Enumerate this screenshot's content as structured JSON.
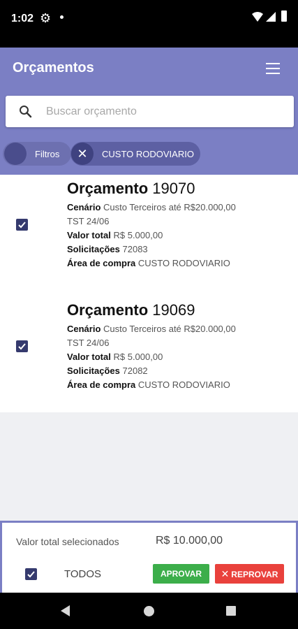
{
  "status_bar": {
    "time": "1:02"
  },
  "header": {
    "title": "Orçamentos",
    "search_placeholder": "Buscar orçamento",
    "chips": {
      "filtros_label": "Filtros",
      "active_filter_label": "CUSTO RODOVIARIO"
    }
  },
  "orcamentos": [
    {
      "title_prefix": "Orçamento",
      "number": "19070",
      "cenario_label": "Cenário",
      "cenario_value": "Custo Terceiros até R$20.000,00",
      "cenario_value_line2": "TST 24/06",
      "valor_label": "Valor total",
      "valor_value": "R$ 5.000,00",
      "solicitacoes_label": "Solicitações",
      "solicitacoes_value": "72083",
      "area_label": "Área de compra",
      "area_value": "CUSTO RODOVIARIO",
      "checked": true
    },
    {
      "title_prefix": "Orçamento",
      "number": "19069",
      "cenario_label": "Cenário",
      "cenario_value": "Custo Terceiros até R$20.000,00",
      "cenario_value_line2": "TST 24/06",
      "valor_label": "Valor total",
      "valor_value": "R$ 5.000,00",
      "solicitacoes_label": "Solicitações",
      "solicitacoes_value": "72082",
      "area_label": "Área de compra",
      "area_value": "CUSTO RODOVIARIO",
      "checked": true
    }
  ],
  "footer": {
    "valor_total_label": "Valor total selecionados",
    "valor_total_value": "R$ 10.000,00",
    "todos_label": "TODOS",
    "todos_checked": true,
    "aprovar_label": "APROVAR",
    "reprovar_label": "REPROVAR"
  },
  "colors": {
    "header": "#7b7fc4",
    "checkbox": "#353a6e",
    "aprovar": "#3cae4a",
    "reprovar": "#e9413c",
    "background": "#eff0f3"
  },
  "icons": [
    "gear-icon",
    "notification-dot-icon",
    "wifi-icon",
    "signal-icon",
    "battery-icon",
    "menu-icon",
    "search-icon",
    "close-icon",
    "checkbox-checked-icon",
    "back-icon",
    "home-icon",
    "recents-icon"
  ]
}
